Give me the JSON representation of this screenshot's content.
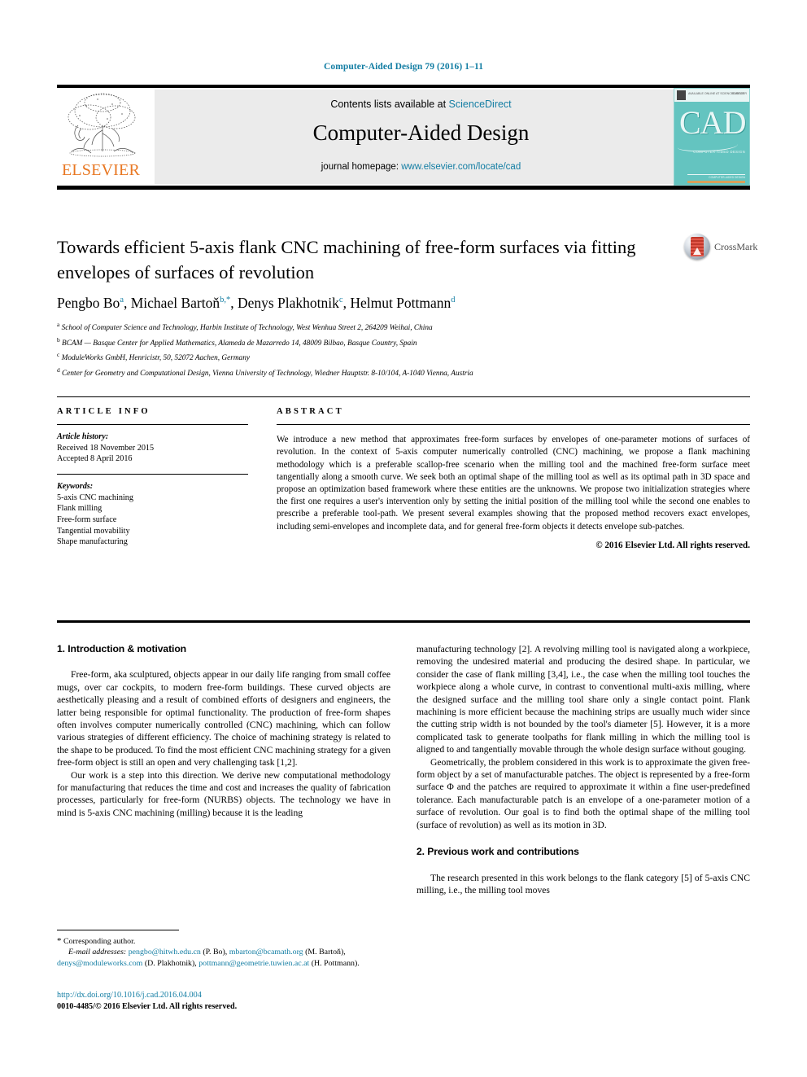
{
  "running_head": "Computer-Aided Design 79 (2016) 1–11",
  "masthead": {
    "publisher_name": "ELSEVIER",
    "contents_prefix": "Contents lists available at ",
    "contents_link": "ScienceDirect",
    "journal_name": "Computer-Aided Design",
    "homepage_prefix": "journal homepage: ",
    "homepage_link": "www.elsevier.com/locate/cad",
    "cover": {
      "title": "CAD",
      "subtitle": "COMPUTER-AIDED DESIGN",
      "top_left_text": "AVAILABLE ONLINE AT SCIENCEDIRECT",
      "top_right_text": "ELSEVIER",
      "footer_text": "COMPUTER-AIDED DESIGN"
    }
  },
  "article": {
    "title": "Towards efficient 5-axis flank CNC machining of free-form surfaces via fitting envelopes of surfaces of revolution",
    "crossmark_label": "CrossMark",
    "authors_html": "Pengbo Bo<sup>a</sup>, Michael Bartoň<sup>b,*</sup>, Denys Plakhotnik<sup>c</sup>, Helmut Pottmann<sup>d</sup>",
    "affiliations": [
      {
        "marker": "a",
        "text": "School of Computer Science and Technology, Harbin Institute of Technology, West Wenhua Street 2, 264209 Weihai, China"
      },
      {
        "marker": "b",
        "text": "BCAM — Basque Center for Applied Mathematics, Alameda de Mazarredo 14, 48009 Bilbao, Basque Country, Spain"
      },
      {
        "marker": "c",
        "text": "ModuleWorks GmbH, Henricistr, 50, 52072 Aachen, Germany"
      },
      {
        "marker": "d",
        "text": "Center for Geometry and Computational Design, Vienna University of Technology, Wiedner Hauptstr. 8-10/104, A-1040 Vienna, Austria"
      }
    ]
  },
  "article_info": {
    "heading": "ARTICLE INFO",
    "history_label": "Article history:",
    "history": [
      "Received 18 November 2015",
      "Accepted 8 April 2016"
    ],
    "keywords_label": "Keywords:",
    "keywords": [
      "5-axis CNC machining",
      "Flank milling",
      "Free-form surface",
      "Tangential movability",
      "Shape manufacturing"
    ]
  },
  "abstract": {
    "heading": "ABSTRACT",
    "body": "We introduce a new method that approximates free-form surfaces by envelopes of one-parameter motions of surfaces of revolution. In the context of 5-axis computer numerically controlled (CNC) machining, we propose a flank machining methodology which is a preferable scallop-free scenario when the milling tool and the machined free-form surface meet tangentially along a smooth curve. We seek both an optimal shape of the milling tool as well as its optimal path in 3D space and propose an optimization based framework where these entities are the unknowns. We propose two initialization strategies where the first one requires a user's intervention only by setting the initial position of the milling tool while the second one enables to prescribe a preferable tool-path. We present several examples showing that the proposed method recovers exact envelopes, including semi-envelopes and incomplete data, and for general free-form objects it detects envelope sub-patches.",
    "copyright": "© 2016 Elsevier Ltd. All rights reserved."
  },
  "body": {
    "section1_heading": "1. Introduction & motivation",
    "section1_p1": "Free-form, aka sculptured, objects appear in our daily life ranging from small coffee mugs, over car cockpits, to modern free-form buildings. These curved objects are aesthetically pleasing and a result of combined efforts of designers and engineers, the latter being responsible for optimal functionality. The production of free-form shapes often involves computer numerically controlled (CNC) machining, which can follow various strategies of different efficiency. The choice of machining strategy is related to the shape to be produced. To find the most efficient CNC machining strategy for a given free-form object is still an open and very challenging task [1,2].",
    "section1_p2": "Our work is a step into this direction. We derive new computational methodology for manufacturing that reduces the time and cost and increases the quality of fabrication processes, particularly for free-form (NURBS) objects. The technology we have in mind is 5-axis CNC machining (milling) because it is the leading",
    "section1_p3": "manufacturing technology [2]. A revolving milling tool is navigated along a workpiece, removing the undesired material and producing the desired shape. In particular, we consider the case of flank milling [3,4], i.e., the case when the milling tool touches the workpiece along a whole curve, in contrast to conventional multi-axis milling, where the designed surface and the milling tool share only a single contact point. Flank machining is more efficient because the machining strips are usually much wider since the cutting strip width is not bounded by the tool's diameter [5]. However, it is a more complicated task to generate toolpaths for flank milling in which the milling tool is aligned to and tangentially movable through the whole design surface without gouging.",
    "section1_p4": "Geometrically, the problem considered in this work is to approximate the given free-form object by a set of manufacturable patches. The object is represented by a free-form surface Φ and the patches are required to approximate it within a fine user-predefined tolerance. Each manufacturable patch is an envelope of a one-parameter motion of a surface of revolution. Our goal is to find both the optimal shape of the milling tool (surface of revolution) as well as its motion in 3D.",
    "section2_heading": "2. Previous work and contributions",
    "section2_p1": "The research presented in this work belongs to the flank category [5] of 5-axis CNC milling, i.e., the milling tool moves"
  },
  "footnote": {
    "corresponding": "Corresponding author.",
    "email_label": "E-mail addresses:",
    "emails": [
      {
        "address": "pengbo@hitwh.edu.cn",
        "owner": "(P. Bo)"
      },
      {
        "address": "mbarton@bcamath.org",
        "owner": "(M. Bartoň)"
      },
      {
        "address": "denys@moduleworks.com",
        "owner": "(D. Plakhotnik)"
      },
      {
        "address": "pottmann@geometrie.tuwien.ac.at",
        "owner": "(H. Pottmann)"
      }
    ],
    "doi": "http://dx.doi.org/10.1016/j.cad.2016.04.004",
    "issn_line": "0010-4485/© 2016 Elsevier Ltd. All rights reserved."
  },
  "colors": {
    "link_blue": "#127da3",
    "elsevier_orange": "#e87722",
    "panel_gray": "#ebebeb",
    "cover_teal": "#64c4c0"
  }
}
